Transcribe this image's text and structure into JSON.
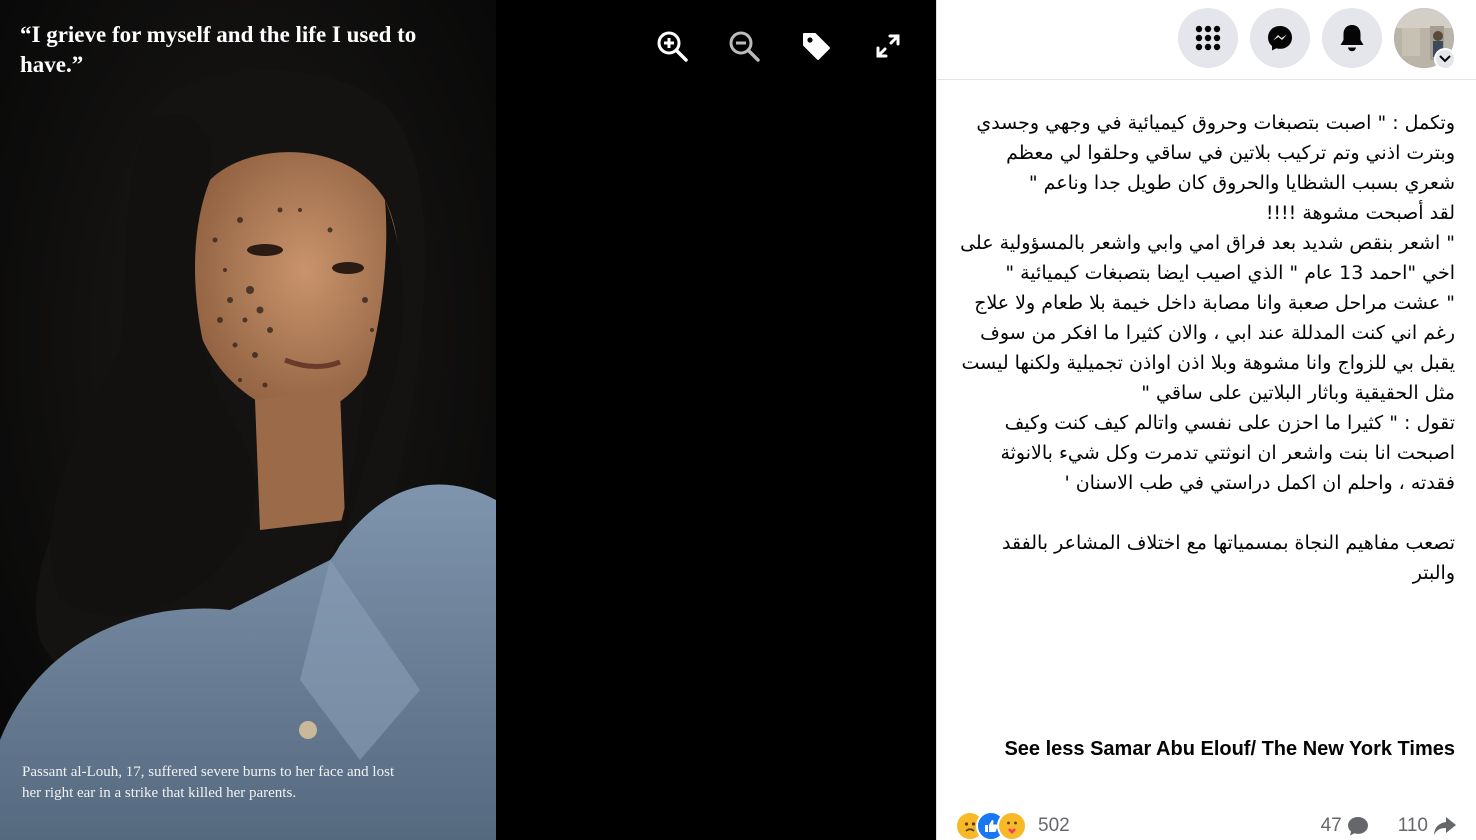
{
  "photo": {
    "quote": "“I grieve for myself and the life I used to have.”",
    "caption": "Passant al-Louh, 17, suffered severe burns to her face and lost her right ear in a strike that killed her parents."
  },
  "viewer_tools": [
    {
      "name": "zoom-in-icon"
    },
    {
      "name": "zoom-out-icon"
    },
    {
      "name": "tag-icon"
    },
    {
      "name": "fullscreen-icon"
    }
  ],
  "topbar": {
    "icons": [
      "menu-grid-icon",
      "messenger-icon",
      "notifications-icon"
    ],
    "avatar": "profile-avatar"
  },
  "post": {
    "paragraph1": "وتكمل : \" اصبت بتصبغات وحروق كيميائية في وجهي وجسدي وبترت اذني وتم تركيب بلاتين في ساقي وحلقوا لي معظم شعري بسبب الشظايا والحروق كان طويل جدا وناعم \"",
    "paragraph2": "لقد أصبحت مشوهة !!!!",
    "paragraph3": "\" اشعر بنقص شديد بعد فراق امي وابي واشعر بالمسؤولية على اخي \"احمد 13 عام \" الذي اصيب ايضا بتصبغات كيميائية \"",
    "paragraph4": "\" عشت مراحل صعبة وانا مصابة داخل خيمة بلا طعام ولا علاج رغم اني كنت المدللة عند ابي ، والان كثيرا ما افكر من سوف يقبل بي للزواج وانا مشوهة وبلا اذن اواذن تجميلية ولكنها ليست مثل الحقيقية وباثار البلاتين على ساقي \"",
    "paragraph5": "تقول : \" كثيرا ما احزن على نفسي واتالم كيف كنت وكيف اصبحت انا بنت واشعر ان انوثتي تدمرت وكل شيء بالانوثة فقدته ، واحلم ان اكمل دراستي في طب الاسنان '",
    "paragraph6": "تصعب مفاهيم النجاة بمسمياتها مع اختلاف المشاعر بالفقد والبتر",
    "see_less": "See less",
    "credit": "Samar Abu Elouf/ The New York Times"
  },
  "reactions": {
    "types": [
      "sad",
      "like",
      "care"
    ],
    "count": "502",
    "comments": "47",
    "shares": "110"
  },
  "colors": {
    "like_blue": "#1877f2",
    "sad_yellow": "#f7b928",
    "icon_gray": "#e4e6eb"
  }
}
